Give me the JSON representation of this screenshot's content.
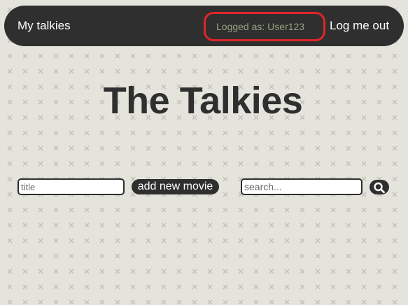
{
  "navbar": {
    "home_label": "My talkies",
    "user_status": "Logged as: User123",
    "logout_label": "Log me out"
  },
  "main": {
    "title": "The Talkies",
    "add_form": {
      "title_placeholder": "title",
      "add_button_label": "add new movie"
    },
    "search": {
      "placeholder": "search...",
      "button_icon": "search-icon"
    }
  },
  "colors": {
    "background": "#e4e4dc",
    "navbar": "#2f2f2f",
    "user_status_text": "#93a47f",
    "highlight_outline": "#e0242a",
    "pattern_mark": "#c0c0b8"
  }
}
